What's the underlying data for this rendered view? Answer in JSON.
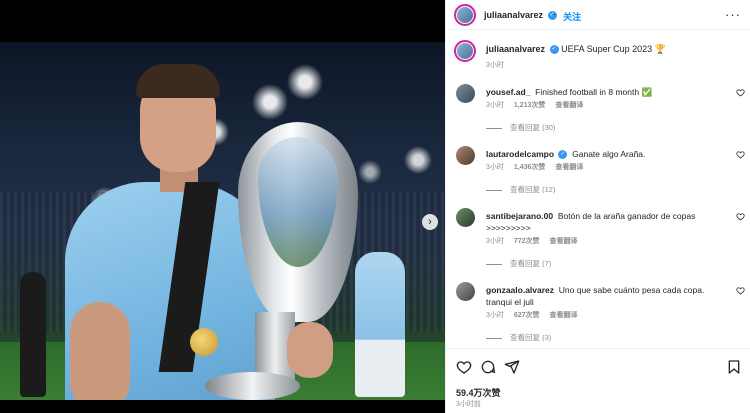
{
  "post": {
    "author": "juliaanalvarez",
    "follow_label": "关注",
    "separator": "·",
    "more_label": "···",
    "caption_text": "UEFA Super Cup 2023 🏆",
    "caption_time": "3小时",
    "likes_total": "59.4万次赞",
    "post_time": "3小时前"
  },
  "media": {
    "next_label": "›"
  },
  "comments": [
    {
      "username": "yousef.ad_",
      "text": "Finished football in 8 month ✅",
      "time": "3小时",
      "likes": "1,213次赞",
      "translate": "查看翻译",
      "replies": "查看回复 (30)",
      "verified": false
    },
    {
      "username": "lautarodelcampo",
      "text": "Ganate algo Araña.",
      "time": "3小时",
      "likes": "1,436次赞",
      "translate": "查看翻译",
      "replies": "查看回复 (12)",
      "verified": true
    },
    {
      "username": "santibejarano.00",
      "text": "Botón de la araña ganador de copas >>>>>>>>>",
      "time": "3小时",
      "likes": "772次赞",
      "translate": "查看翻译",
      "replies": "查看回复 (7)",
      "verified": false
    },
    {
      "username": "gonzaalo.alvarez",
      "text": "Uno que sabe cuánto pesa cada copa. tranqui el juli",
      "time": "3小时",
      "likes": "627次赞",
      "translate": "查看翻译",
      "replies": "查看回复 (3)",
      "verified": false
    }
  ],
  "icons": {
    "like": "heart-icon",
    "comment": "comment-icon",
    "share": "share-icon",
    "save": "bookmark-icon"
  },
  "colors": {
    "link_blue": "#0095f6",
    "verified_blue": "#3897f0",
    "muted_text": "#8e8e8e"
  }
}
